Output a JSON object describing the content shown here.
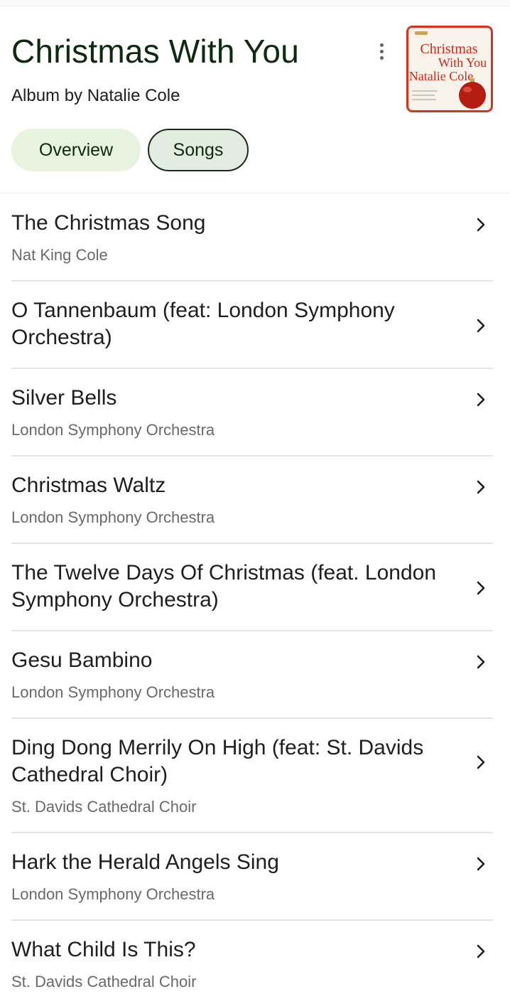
{
  "album": {
    "title": "Christmas With You",
    "subtitle": "Album by Natalie Cole",
    "cover": {
      "line1": "Christmas",
      "line2": "With You",
      "line3": "Natalie Cole",
      "colors": {
        "background": "#f7f2ea",
        "border": "#d8331e",
        "text": "#cf2a1a",
        "ornament": "#b51d12"
      }
    },
    "menu_icon": "more-vert-icon"
  },
  "tabs": [
    {
      "label": "Overview",
      "selected": false
    },
    {
      "label": "Songs",
      "selected": true
    }
  ],
  "songs": [
    {
      "title": "The Christmas Song",
      "artist": "Nat King Cole"
    },
    {
      "title": "O Tannenbaum (feat: London Symphony Orchestra)",
      "artist": ""
    },
    {
      "title": "Silver Bells",
      "artist": "London Symphony Orchestra"
    },
    {
      "title": "Christmas Waltz",
      "artist": "London Symphony Orchestra"
    },
    {
      "title": "The Twelve Days Of Christmas (feat. London Symphony Orchestra)",
      "artist": ""
    },
    {
      "title": "Gesu Bambino",
      "artist": "London Symphony Orchestra"
    },
    {
      "title": "Ding Dong Merrily On High (feat: St. Davids Cathedral Choir)",
      "artist": "St. Davids Cathedral Choir"
    },
    {
      "title": "Hark the Herald Angels Sing",
      "artist": "London Symphony Orchestra"
    },
    {
      "title": "What Child Is This?",
      "artist": "St. Davids Cathedral Choir"
    }
  ],
  "icons": {
    "row_chevron": "chevron-right-icon"
  },
  "colors": {
    "title": "#0e2a0e",
    "tab_fill": "#e7f2df",
    "divider": "#e6e6e6",
    "secondary_text": "#6a6a6a"
  }
}
